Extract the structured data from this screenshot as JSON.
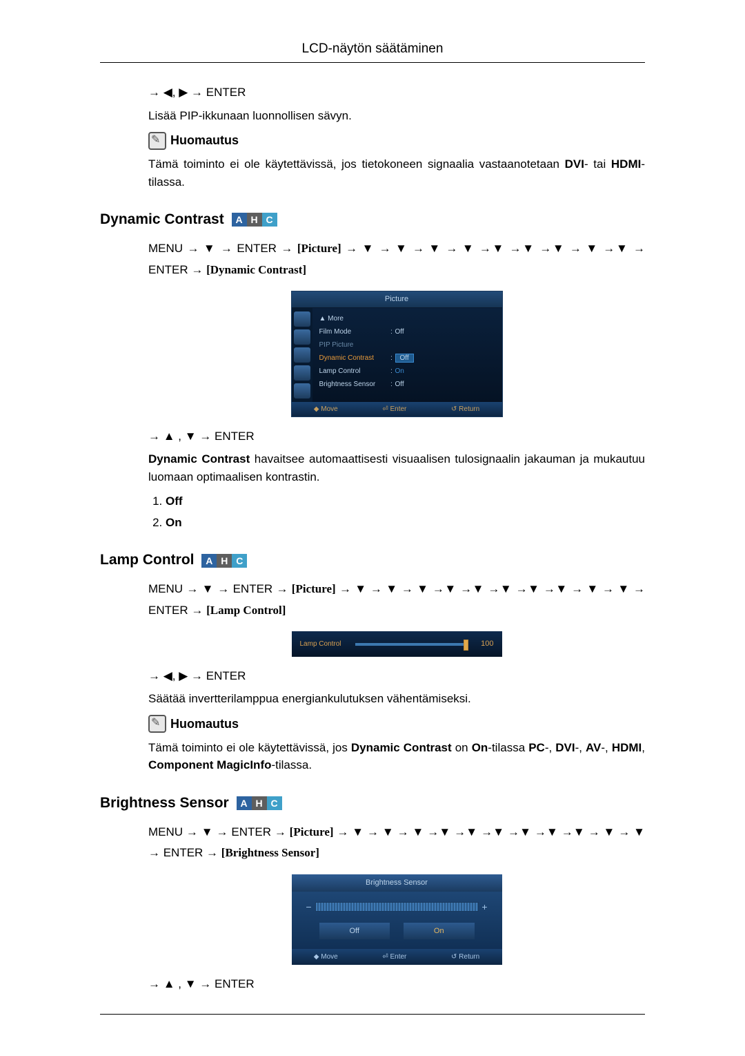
{
  "page": {
    "header": "LCD-näytön säätäminen"
  },
  "intro": {
    "nav": "→ ◀, ▶ → ENTER",
    "desc": "Lisää PIP-ikkunaan luonnollisen sävyn.",
    "note_label": "Huomautus",
    "note_text_pre": "Tämä toiminto ei ole käytettävissä, jos tietokoneen signaalia vastaanotetaan ",
    "note_dvi": "DVI",
    "note_mid": "- tai ",
    "note_hdmi": "HDMI",
    "note_suffix": "-tilassa."
  },
  "badges": {
    "a": "A",
    "h": "H",
    "c": "C"
  },
  "dynamic_contrast": {
    "title": "Dynamic Contrast",
    "path_pre": "MENU → ▼ → ENTER → ",
    "path_picture": "[Picture]",
    "path_post": " → ▼ → ▼ → ▼ → ▼ →▼ →▼ →▼ → ▼ →▼ → ENTER → ",
    "path_label": "[Dynamic Contrast]",
    "nav2": "→ ▲ , ▼ → ENTER",
    "desc_bold": "Dynamic Contrast",
    "desc_rest": " havaitsee automaattisesti visuaalisen tulosignaalin jakauman ja mukautuu luomaan optimaalisen kontrastin.",
    "opt1": "Off",
    "opt2": "On"
  },
  "osd1": {
    "title": "Picture",
    "more": "▲ More",
    "rows": [
      {
        "label": "Film Mode",
        "val": "Off"
      },
      {
        "label": "PIP Picture",
        "val": ""
      },
      {
        "label": "Dynamic Contrast",
        "val": "Off"
      },
      {
        "label": "Lamp Control",
        "val": "On"
      },
      {
        "label": "Brightness Sensor",
        "val": "Off"
      }
    ],
    "foot": {
      "move": "◆ Move",
      "enter": "⏎ Enter",
      "ret": "↺ Return"
    }
  },
  "lamp_control": {
    "title": "Lamp Control",
    "path_pre": "MENU → ▼ → ENTER → ",
    "path_picture": "[Picture]",
    "path_post": " → ▼ → ▼ → ▼ →▼ →▼ →▼ →▼ →▼ → ▼ → ▼ → ENTER → ",
    "path_label": "[Lamp Control]",
    "nav2": "→ ◀, ▶ → ENTER",
    "desc": "Säätää invertterilamppua energiankulutuksen vähentämiseksi.",
    "note_label": "Huomautus",
    "note_pre": "Tämä toiminto ei ole käytettävissä, jos ",
    "note_dc": "Dynamic Contrast",
    "note_mid1": " on ",
    "note_on": "On",
    "note_mid2": "-tilassa ",
    "note_pc": "PC",
    "note_dvi": "DVI",
    "note_av": "AV",
    "note_hdmi": "HDMI",
    "note_comp": "Component MagicInfo",
    "note_suffix": "-tilassa."
  },
  "osd2": {
    "label": "Lamp Control",
    "value": "100"
  },
  "brightness_sensor": {
    "title": "Brightness Sensor",
    "path_pre": "MENU → ▼ → ENTER → ",
    "path_picture": "[Picture]",
    "path_post": " → ▼ → ▼ → ▼ →▼ →▼ →▼ →▼ →▼ →▼ → ▼ → ▼ → ENTER → ",
    "path_label": "[Brightness Sensor]",
    "nav2": "→ ▲ , ▼ → ENTER"
  },
  "osd3": {
    "title": "Brightness Sensor",
    "minus": "−",
    "plus": "+",
    "off": "Off",
    "on": "On",
    "foot": {
      "move": "◆ Move",
      "enter": "⏎ Enter",
      "ret": "↺ Return"
    }
  }
}
